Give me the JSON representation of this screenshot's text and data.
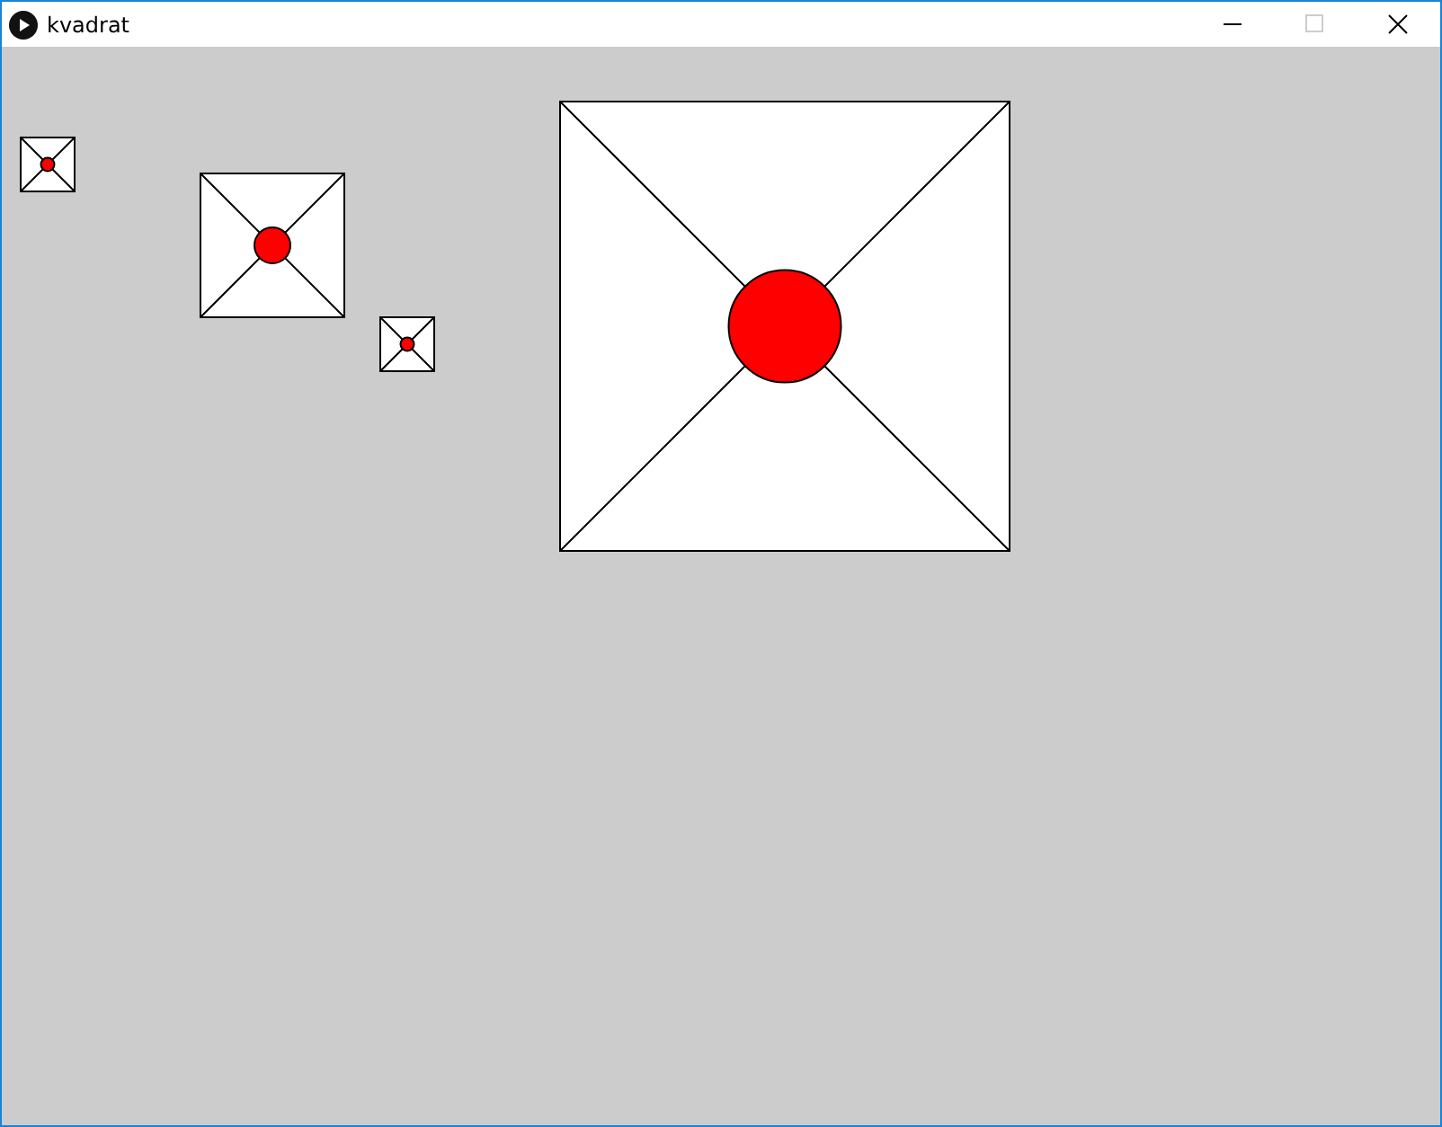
{
  "window": {
    "title": "kvadrat",
    "controls": [
      {
        "kind": "minimize",
        "disabled": false
      },
      {
        "kind": "maximize",
        "disabled": true
      },
      {
        "kind": "close",
        "disabled": false
      }
    ]
  }
}
